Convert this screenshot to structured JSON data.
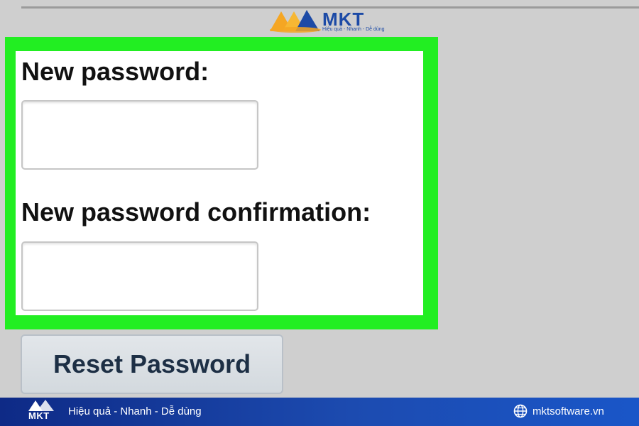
{
  "watermark": {
    "brand": "MKT",
    "tagline": "Hiệu quả - Nhanh - Dễ dùng"
  },
  "form": {
    "new_password_label": "New password:",
    "new_password_value": "",
    "confirm_label": "New password confirmation:",
    "confirm_value": "",
    "reset_button_label": "Reset Password"
  },
  "footer": {
    "brand": "MKT",
    "tagline": "Hiệu quả - Nhanh - Dễ dùng",
    "website": "mktsoftware.vn"
  },
  "icons": {
    "logo": "mkt-logo-icon",
    "footer_logo": "mkt-footer-logo-icon",
    "website": "globe-icon"
  },
  "colors": {
    "highlight": "#22ee22",
    "brand_blue": "#1c4aa6",
    "brand_orange": "#f5a623",
    "button_text": "#1d2f45"
  }
}
